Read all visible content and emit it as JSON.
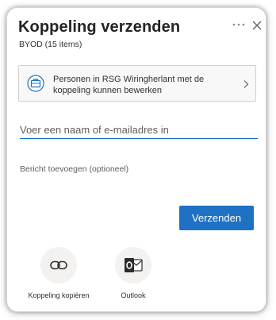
{
  "dialog": {
    "title": "Koppeling verzenden",
    "subtitle": "BYOD (15 items)",
    "permission": {
      "line1": "Personen in RSG Wiringherlant met de",
      "line2": "koppeling kunnen bewerken"
    },
    "recipient": {
      "placeholder": "Voer een naam of e-mailadres in",
      "value": ""
    },
    "message": {
      "placeholder": "Bericht toevoegen (optioneel)",
      "value": ""
    },
    "send_label": "Verzenden",
    "share_options": [
      {
        "label": "Koppeling kopiëren",
        "icon": "link-icon"
      },
      {
        "label": "Outlook",
        "icon": "outlook-icon"
      }
    ]
  },
  "colors": {
    "accent": "#1f71c4",
    "input_underline": "#0f6cbd",
    "outlook_blue": "#0a5ab8"
  }
}
